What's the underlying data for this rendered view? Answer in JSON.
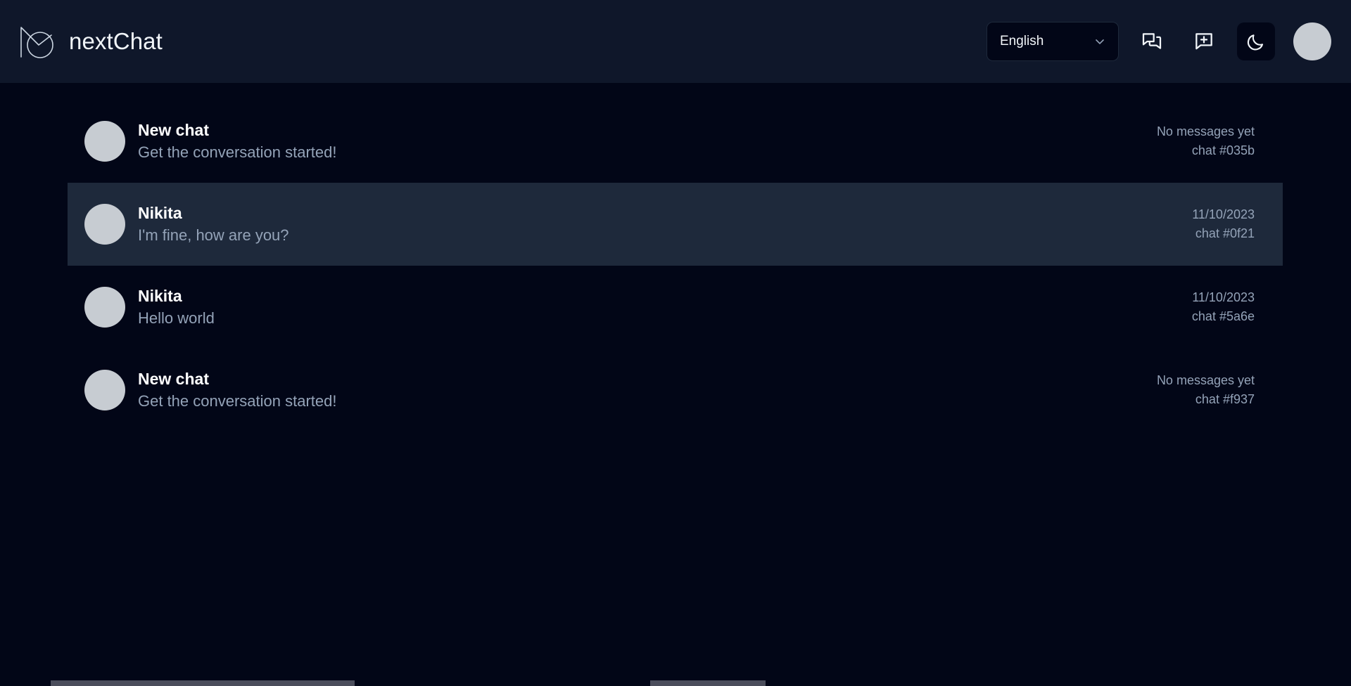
{
  "app": {
    "name": "nextChat",
    "logo_icon": "nextchat-monogram-logo"
  },
  "header": {
    "language_select": {
      "value": "English",
      "icon": "chevron-down-icon"
    },
    "buttons": [
      {
        "name": "chats-icon",
        "label": "Chats"
      },
      {
        "name": "new-chat-icon",
        "label": "New chat"
      },
      {
        "name": "moon-icon",
        "label": "Toggle dark mode"
      }
    ],
    "avatar": {
      "name": "user-avatar",
      "alt": "User profile photo"
    }
  },
  "chat_list": {
    "rows": [
      {
        "title": "New chat",
        "preview": "Get the conversation started!",
        "date": "No messages yet",
        "chat_id": "chat #035b",
        "selected": false
      },
      {
        "title": "Nikita",
        "preview": "I'm fine, how are you?",
        "date": "11/10/2023",
        "chat_id": "chat #0f21",
        "selected": true
      },
      {
        "title": "Nikita",
        "preview": "Hello world",
        "date": "11/10/2023",
        "chat_id": "chat #5a6e",
        "selected": false
      },
      {
        "title": "New chat",
        "preview": "Get the conversation started!",
        "date": "No messages yet",
        "chat_id": "chat #f937",
        "selected": false
      }
    ]
  },
  "colors": {
    "header_bg": "#0f172a",
    "body_bg": "#020617",
    "row_selected_bg": "#1e293b",
    "text_primary": "#ffffff",
    "text_muted": "#94a3b8",
    "border": "#1e293b"
  }
}
